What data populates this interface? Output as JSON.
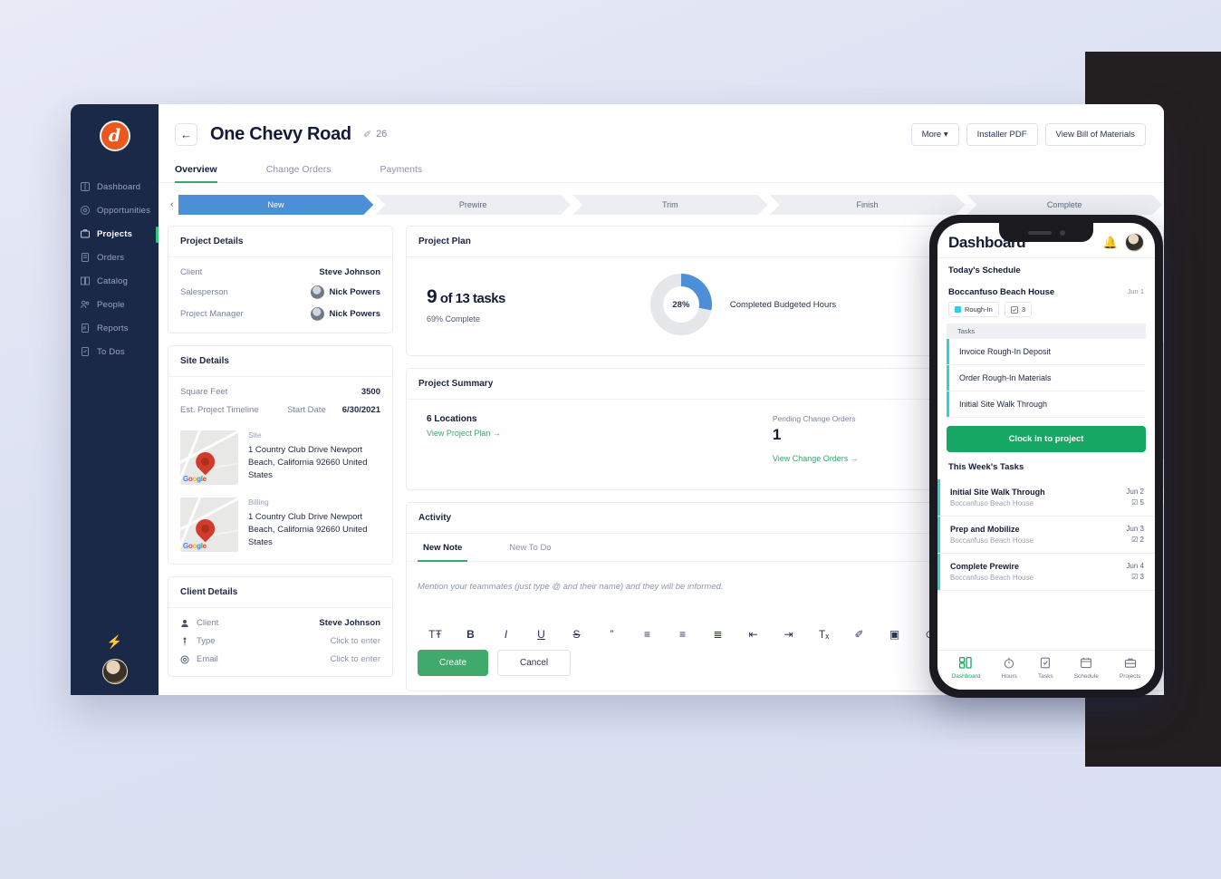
{
  "sidebar": {
    "logo_letter": "d",
    "items": [
      {
        "label": "Dashboard",
        "icon": "dashboard-icon"
      },
      {
        "label": "Opportunities",
        "icon": "opportunities-icon"
      },
      {
        "label": "Projects",
        "icon": "projects-icon"
      },
      {
        "label": "Orders",
        "icon": "orders-icon"
      },
      {
        "label": "Catalog",
        "icon": "catalog-icon"
      },
      {
        "label": "People",
        "icon": "people-icon"
      },
      {
        "label": "Reports",
        "icon": "reports-icon"
      },
      {
        "label": "To Dos",
        "icon": "todos-icon"
      }
    ]
  },
  "header": {
    "back_icon": "←",
    "title": "One Chevy Road",
    "edit_icon": "✐",
    "number": "26",
    "buttons": [
      {
        "label": "More ▾"
      },
      {
        "label": "Installer PDF"
      },
      {
        "label": "View Bill of Materials"
      }
    ]
  },
  "tabs": [
    {
      "label": "Overview"
    },
    {
      "label": "Change Orders"
    },
    {
      "label": "Payments"
    }
  ],
  "stages": {
    "prev_icon": "‹",
    "items": [
      "New",
      "Prewire",
      "Trim",
      "Finish",
      "Complete"
    ],
    "active": "New"
  },
  "project_details": {
    "title": "Project Details",
    "rows": [
      {
        "label": "Client",
        "value": "Steve Johnson",
        "avatar": false
      },
      {
        "label": "Salesperson",
        "value": "Nick Powers",
        "avatar": true
      },
      {
        "label": "Project Manager",
        "value": "Nick Powers",
        "avatar": true
      }
    ]
  },
  "site_details": {
    "title": "Site Details",
    "square_feet_label": "Square Feet",
    "square_feet_value": "3500",
    "timeline_label": "Est. Project Timeline",
    "start_date_label": "Start Date",
    "start_date_value": "6/30/2021",
    "addresses": [
      {
        "type": "Site",
        "text": "1 Country Club Drive Newport Beach, California 92660 United States",
        "watermark": "Google"
      },
      {
        "type": "Billing",
        "text": "1 Country Club Drive Newport Beach, California 92660 United States",
        "watermark": "Google"
      }
    ]
  },
  "client_details": {
    "title": "Client Details",
    "rows": [
      {
        "icon": "person-icon",
        "label": "Client",
        "value": "Steve Johnson"
      },
      {
        "icon": "type-icon",
        "label": "Type",
        "value": "Click to enter"
      },
      {
        "icon": "at-icon",
        "label": "Email",
        "value": "Click to enter"
      }
    ]
  },
  "project_plan": {
    "title": "Project Plan",
    "tasks_done": "9",
    "tasks_of": " of 13 tasks",
    "percent_complete": "69% Complete",
    "donut_label": "28%",
    "donut_caption": "Completed Budgeted Hours"
  },
  "project_summary": {
    "title": "Project Summary",
    "locations": "6 Locations",
    "view_plan_link": "View Project Plan  →",
    "pending_label": "Pending Change Orders",
    "pending_count": "1",
    "view_orders_link": "View Change Orders  →"
  },
  "activity": {
    "title": "Activity",
    "tabs": [
      {
        "label": "New Note"
      },
      {
        "label": "New To Do"
      }
    ],
    "placeholder": "Mention your teammates (just type @ and their name) and they will be informed.",
    "toolbar": [
      {
        "icon": "text-size-icon",
        "glyph": "TŦ"
      },
      {
        "icon": "bold-icon",
        "glyph": "B"
      },
      {
        "icon": "italic-icon",
        "glyph": "I"
      },
      {
        "icon": "underline-icon",
        "glyph": "U"
      },
      {
        "icon": "strikethrough-icon",
        "glyph": "S"
      },
      {
        "icon": "quote-icon",
        "glyph": "”"
      },
      {
        "icon": "align-left-icon",
        "glyph": "≡"
      },
      {
        "icon": "align-center-icon",
        "glyph": "≡"
      },
      {
        "icon": "ordered-list-icon",
        "glyph": "≣"
      },
      {
        "icon": "indent-decrease-icon",
        "glyph": "⇤"
      },
      {
        "icon": "indent-increase-icon",
        "glyph": "⇥"
      },
      {
        "icon": "clear-format-icon",
        "glyph": "Tₓ"
      },
      {
        "icon": "attachment-icon",
        "glyph": "✐"
      },
      {
        "icon": "image-icon",
        "glyph": "▣"
      },
      {
        "icon": "emoji-icon",
        "glyph": "⊙"
      }
    ],
    "create_label": "Create",
    "cancel_label": "Cancel"
  },
  "phone": {
    "title": "Dashboard",
    "bell_icon": "♡",
    "today_label": "Today's Schedule",
    "project": {
      "name": "Boccanfuso Beach House",
      "date": "Jun 1",
      "stage_chip": "Rough-In",
      "count_chip": "3",
      "tasks_header": "Tasks",
      "tasks": [
        "Invoice Rough-In Deposit",
        "Order Rough-In Materials",
        "Initial Site Walk Through"
      ]
    },
    "clock_in_label": "Clock in to project",
    "week_label": "This Week's Tasks",
    "week_tasks": [
      {
        "name": "Initial Site Walk Through",
        "project": "Boccanfuso Beach House",
        "date": "Jun 2",
        "count": "5"
      },
      {
        "name": "Prep and Mobilize",
        "project": "Boccanfuso Beach House",
        "date": "Jun 3",
        "count": "2"
      },
      {
        "name": "Complete Prewire",
        "project": "Boccanfuso Beach House",
        "date": "Jun 4",
        "count": "3"
      }
    ],
    "nav": [
      {
        "label": "Dashboard",
        "icon": "grid-icon",
        "glyph": "▤"
      },
      {
        "label": "Hours",
        "icon": "stopwatch-icon",
        "glyph": "◴"
      },
      {
        "label": "Tasks",
        "icon": "clipboard-check-icon",
        "glyph": "☑"
      },
      {
        "label": "Schedule",
        "icon": "calendar-icon",
        "glyph": "▦"
      },
      {
        "label": "Projects",
        "icon": "briefcase-icon",
        "glyph": "▭"
      }
    ]
  },
  "colors": {
    "sidebar_bg": "#1b2949",
    "accent_green": "#3aa76d",
    "stage_blue": "#4d8fd6",
    "brand_orange": "#e8581f",
    "phone_cyan": "#35cde0",
    "phone_green": "#16a765"
  }
}
